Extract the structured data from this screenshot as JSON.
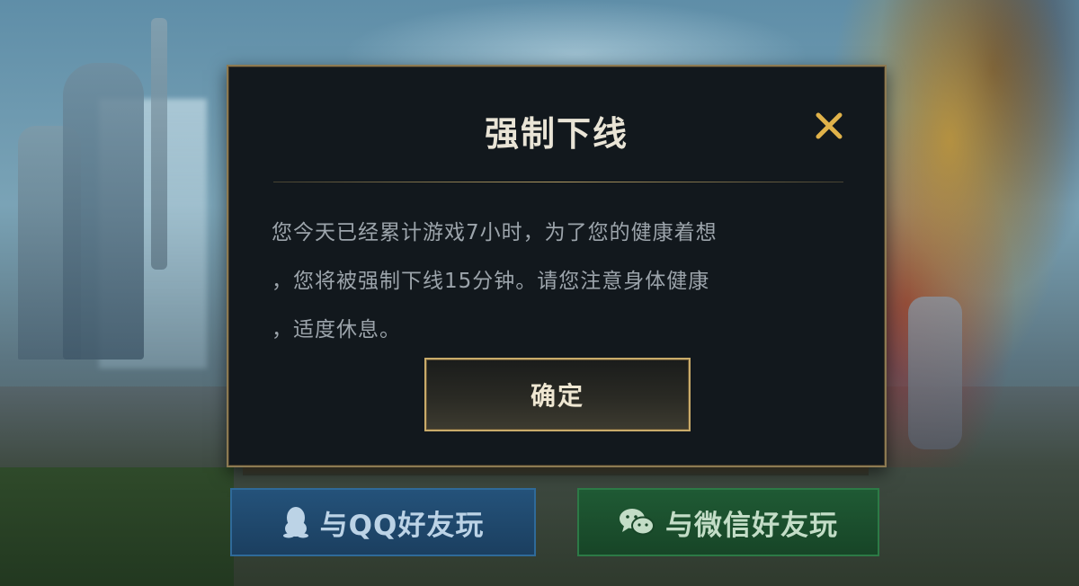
{
  "dialog": {
    "title": "强制下线",
    "message_lines": [
      "您今天已经累计游戏7小时，为了您的健康着想",
      "，您将被强制下线15分钟。请您注意身体健康",
      "，适度休息。"
    ],
    "confirm_label": "确定",
    "close_icon": "close-icon",
    "accent_color": "#c9ab6a"
  },
  "bottom_buttons": {
    "qq": {
      "label": "与QQ好友玩",
      "icon": "qq-penguin-icon"
    },
    "wechat": {
      "label": "与微信好友玩",
      "icon": "wechat-icon"
    }
  }
}
